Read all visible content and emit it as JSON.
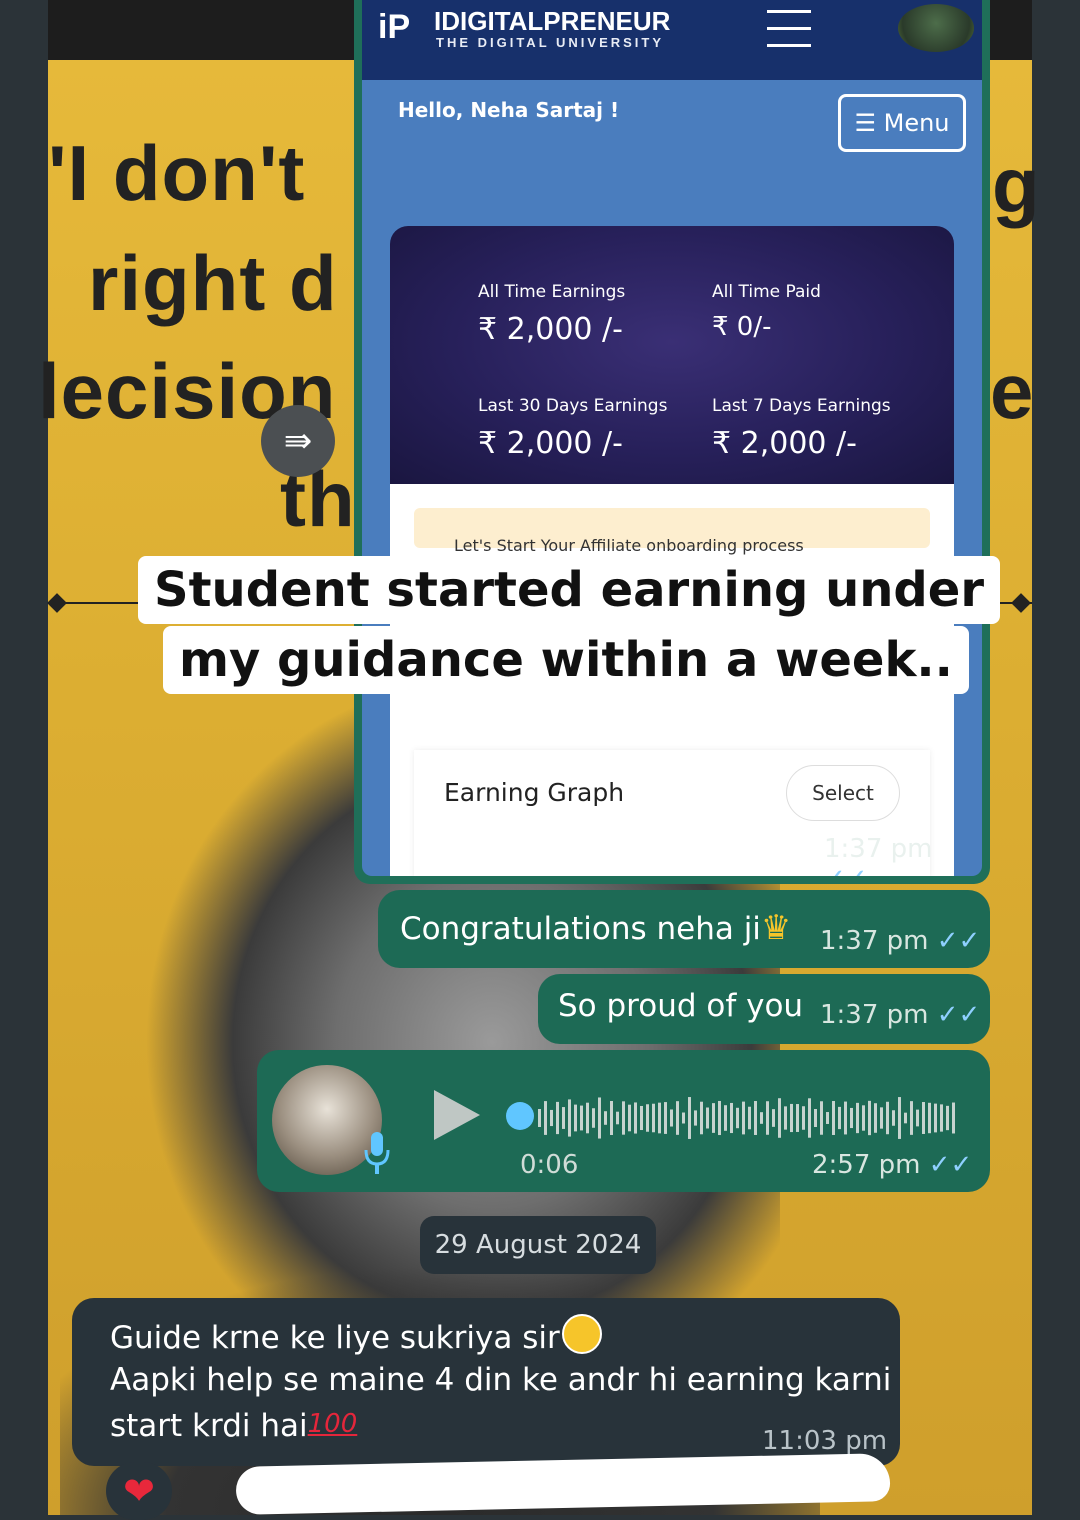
{
  "background": {
    "quote_lines": [
      "'I don't",
      "right d",
      "lecision",
      "th"
    ],
    "quote_right_chars": [
      "g",
      "e"
    ]
  },
  "forwarded_screenshot": {
    "brand": "IDIGITALPRENEUR",
    "brand_logo": "iP",
    "brand_subtitle": "THE DIGITAL UNIVERSITY",
    "greeting": "Hello, Neha Sartaj !",
    "menu_label": "☰ Menu",
    "earnings": [
      {
        "label": "All Time Earnings",
        "value": "₹ 2,000 /-"
      },
      {
        "label": "All Time Paid",
        "value": "₹ 0/-"
      },
      {
        "label": "Last 30 Days Earnings",
        "value": "₹ 2,000 /-"
      },
      {
        "label": "Last 7 Days Earnings",
        "value": "₹ 2,000 /-"
      }
    ],
    "notice_text": "Let's Start Your Affiliate onboarding process",
    "graph_title": "Earning Graph",
    "graph_select": "Select",
    "time": "1:37 pm"
  },
  "caption": {
    "line1": "Student started earning under",
    "line2": "my guidance within a week.."
  },
  "messages": {
    "congrats": {
      "text": "Congratulations neha ji",
      "emoji": "♛",
      "time": "1:37 pm"
    },
    "proud": {
      "text": "So proud of you",
      "time": "1:37 pm"
    },
    "voice": {
      "duration": "0:06",
      "time": "2:57 pm"
    },
    "date_chip": "29 August 2024",
    "reply": {
      "line1": "Guide krne ke liye sukriya sir",
      "line2": "Aapki help se maine 4 din ke andr hi earning karni",
      "line3": "start krdi hai",
      "emoji_100": "100",
      "time": "11:03 pm"
    },
    "reaction": "❤"
  },
  "icons": {
    "forward": "forward-arrow-icon",
    "tick": "double-check-icon",
    "play": "play-icon",
    "mic": "mic-icon"
  },
  "colors": {
    "outgoing_bubble": "#1d6a55",
    "incoming_bubble": "#28333a",
    "tick_blue": "#8fd0ff",
    "wallpaper_yellow": "#e6b93a"
  }
}
